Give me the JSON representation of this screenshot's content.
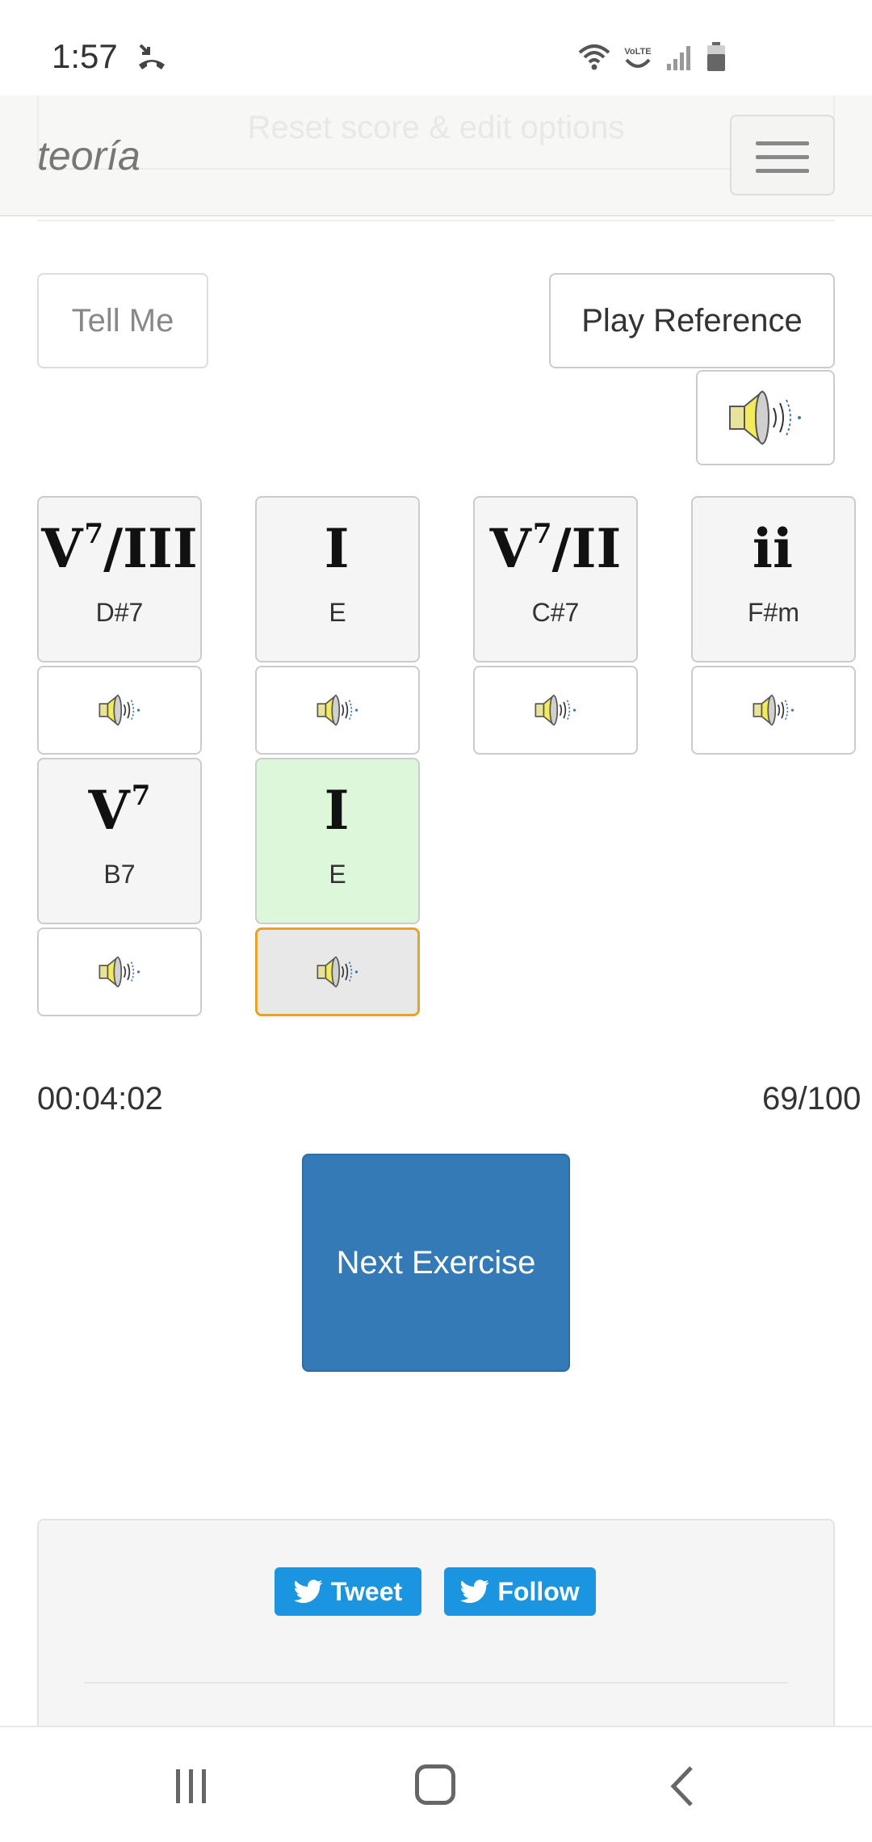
{
  "status_bar": {
    "time": "1:57",
    "icons": [
      "missed-call-icon",
      "wifi-icon",
      "volte-icon",
      "signal-icon",
      "battery-icon"
    ],
    "volte_label": "VoLTE"
  },
  "navbar": {
    "ghost_text": "Reset score & edit options",
    "brand": "teoría",
    "menu_icon": "hamburger-icon"
  },
  "controls": {
    "tell_me": "Tell Me",
    "play_reference": "Play Reference",
    "speaker_icon": "speaker-icon"
  },
  "chords": [
    {
      "roman": "V",
      "sup": "7",
      "slash": "/III",
      "name": "D#7",
      "status": "default"
    },
    {
      "roman": "I",
      "sup": "",
      "slash": "",
      "name": "E",
      "status": "default"
    },
    {
      "roman": "V",
      "sup": "7",
      "slash": "/II",
      "name": "C#7",
      "status": "default"
    },
    {
      "roman": "ii",
      "sup": "",
      "slash": "",
      "name": "F#m",
      "status": "default"
    },
    {
      "roman": "V",
      "sup": "7",
      "slash": "",
      "name": "B7",
      "status": "default"
    },
    {
      "roman": "I",
      "sup": "",
      "slash": "",
      "name": "E",
      "status": "correct"
    }
  ],
  "stats": {
    "timer": "00:04:02",
    "score": "69/100"
  },
  "next_exercise": "Next Exercise",
  "social": {
    "tweet": "Tweet",
    "follow": "Follow"
  },
  "colors": {
    "primary": "#337ab7",
    "correct_bg": "#dcf7da",
    "active_border": "#e5a32a",
    "twitter": "#1b95e0"
  }
}
